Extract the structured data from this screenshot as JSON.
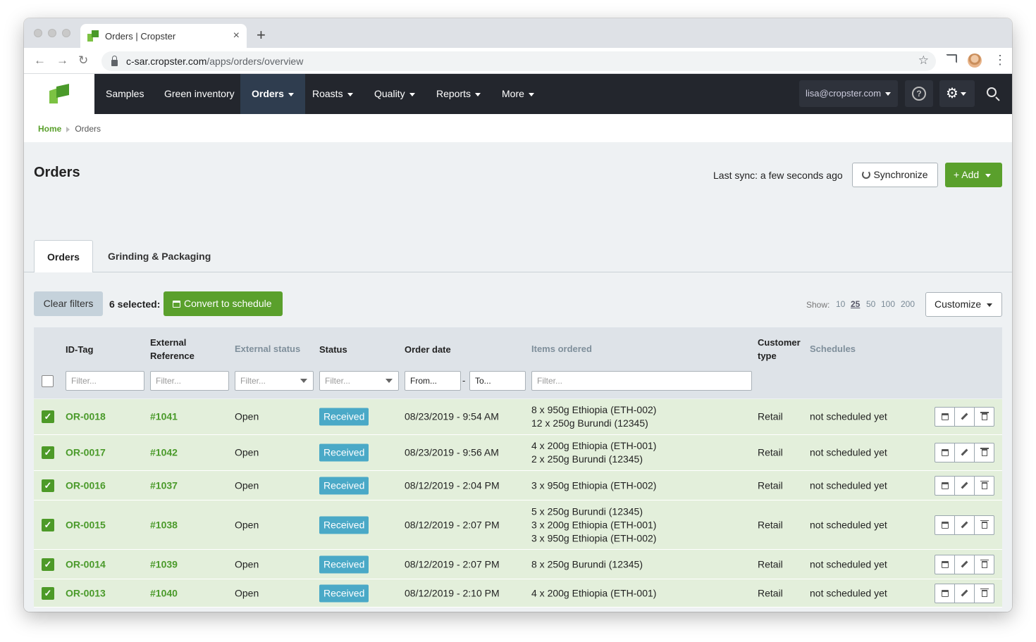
{
  "browser": {
    "tab_title": "Orders | Cropster",
    "close_glyph": "×",
    "new_tab_glyph": "+",
    "url_domain": "c-sar.cropster.com",
    "url_path": "/apps/orders/overview",
    "back_glyph": "←",
    "forward_glyph": "→",
    "reload_glyph": "↻",
    "star_glyph": "☆",
    "menu_glyph": "⋮"
  },
  "nav": {
    "items": [
      "Samples",
      "Green inventory",
      "Orders",
      "Roasts",
      "Quality",
      "Reports",
      "More"
    ],
    "active": "Orders",
    "user": "lisa@cropster.com",
    "help_glyph": "?",
    "gear_glyph": "⚙",
    "brand_color": "#5aa02c"
  },
  "breadcrumb": {
    "home": "Home",
    "current": "Orders"
  },
  "header": {
    "title": "Orders",
    "last_sync": "Last sync: a few seconds ago",
    "sync_label": "Synchronize",
    "add_label": "+ Add"
  },
  "tabs": [
    "Orders",
    "Grinding & Packaging"
  ],
  "toolbar": {
    "clear_filters": "Clear filters",
    "selected": "6 selected:",
    "convert": "Convert to schedule",
    "show_label": "Show:",
    "page_sizes": [
      "10",
      "25",
      "50",
      "100",
      "200"
    ],
    "page_size_selected": "25",
    "customize": "Customize"
  },
  "table": {
    "headers": {
      "id_tag": "ID-Tag",
      "external_reference_1": "External",
      "external_reference_2": "Reference",
      "external_status": "External status",
      "status": "Status",
      "order_date": "Order date",
      "items_ordered": "Items ordered",
      "customer_type_1": "Customer",
      "customer_type_2": "type",
      "schedules": "Schedules"
    },
    "filters": {
      "filter_placeholder": "Filter...",
      "from_placeholder": "From...",
      "to_placeholder": "To...",
      "range_dash": "-"
    },
    "rows": [
      {
        "id": "OR-0018",
        "ref": "#1041",
        "ext_status": "Open",
        "status": "Received",
        "date": "08/23/2019 - 9:54 AM",
        "items": [
          "8 x 950g Ethiopia (ETH-002)",
          "12 x 250g Burundi (12345)"
        ],
        "customer": "Retail",
        "schedule": "not scheduled yet"
      },
      {
        "id": "OR-0017",
        "ref": "#1042",
        "ext_status": "Open",
        "status": "Received",
        "date": "08/23/2019 - 9:56 AM",
        "items": [
          "4 x 200g Ethiopia (ETH-001)",
          "2 x 250g Burundi (12345)"
        ],
        "customer": "Retail",
        "schedule": "not scheduled yet"
      },
      {
        "id": "OR-0016",
        "ref": "#1037",
        "ext_status": "Open",
        "status": "Received",
        "date": "08/12/2019 - 2:04 PM",
        "items": [
          "3 x 950g Ethiopia (ETH-002)"
        ],
        "customer": "Retail",
        "schedule": "not scheduled yet"
      },
      {
        "id": "OR-0015",
        "ref": "#1038",
        "ext_status": "Open",
        "status": "Received",
        "date": "08/12/2019 - 2:07 PM",
        "items": [
          "5 x 250g Burundi (12345)",
          "3 x 200g Ethiopia (ETH-001)",
          "3 x 950g Ethiopia (ETH-002)"
        ],
        "customer": "Retail",
        "schedule": "not scheduled yet"
      },
      {
        "id": "OR-0014",
        "ref": "#1039",
        "ext_status": "Open",
        "status": "Received",
        "date": "08/12/2019 - 2:07 PM",
        "items": [
          "8 x 250g Burundi (12345)"
        ],
        "customer": "Retail",
        "schedule": "not scheduled yet"
      },
      {
        "id": "OR-0013",
        "ref": "#1040",
        "ext_status": "Open",
        "status": "Received",
        "date": "08/12/2019 - 2:10 PM",
        "items": [
          "4 x 200g Ethiopia (ETH-001)"
        ],
        "customer": "Retail",
        "schedule": "not scheduled yet"
      }
    ],
    "check_glyph": "✓"
  }
}
